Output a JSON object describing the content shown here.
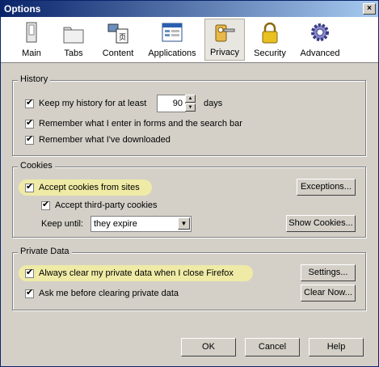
{
  "window": {
    "title": "Options",
    "close_glyph": "×"
  },
  "toolbar": {
    "items": [
      {
        "label": "Main",
        "icon": "main-icon"
      },
      {
        "label": "Tabs",
        "icon": "tabs-icon"
      },
      {
        "label": "Content",
        "icon": "content-icon"
      },
      {
        "label": "Applications",
        "icon": "applications-icon"
      },
      {
        "label": "Privacy",
        "icon": "privacy-icon",
        "selected": true
      },
      {
        "label": "Security",
        "icon": "security-icon"
      },
      {
        "label": "Advanced",
        "icon": "advanced-icon"
      }
    ]
  },
  "history": {
    "title": "History",
    "keep_label": "Keep my history for at least",
    "keep_value": "90",
    "days_label": "days",
    "forms_label": "Remember what I enter in forms and the search bar",
    "downloads_label": "Remember what I've downloaded"
  },
  "cookies": {
    "title": "Cookies",
    "accept_label": "Accept cookies from sites",
    "third_party_label": "Accept third-party cookies",
    "keep_until_label": "Keep until:",
    "keep_until_value": "they expire",
    "exceptions_button": "Exceptions...",
    "show_cookies_button": "Show Cookies..."
  },
  "private_data": {
    "title": "Private Data",
    "always_clear_label": "Always clear my private data when I close Firefox",
    "ask_label": "Ask me before clearing private data",
    "settings_button": "Settings...",
    "clear_now_button": "Clear Now..."
  },
  "footer": {
    "ok": "OK",
    "cancel": "Cancel",
    "help": "Help"
  },
  "colors": {
    "highlight": "#f3f0a0",
    "titlebar": "#0a246a",
    "face": "#d4d0c8"
  }
}
